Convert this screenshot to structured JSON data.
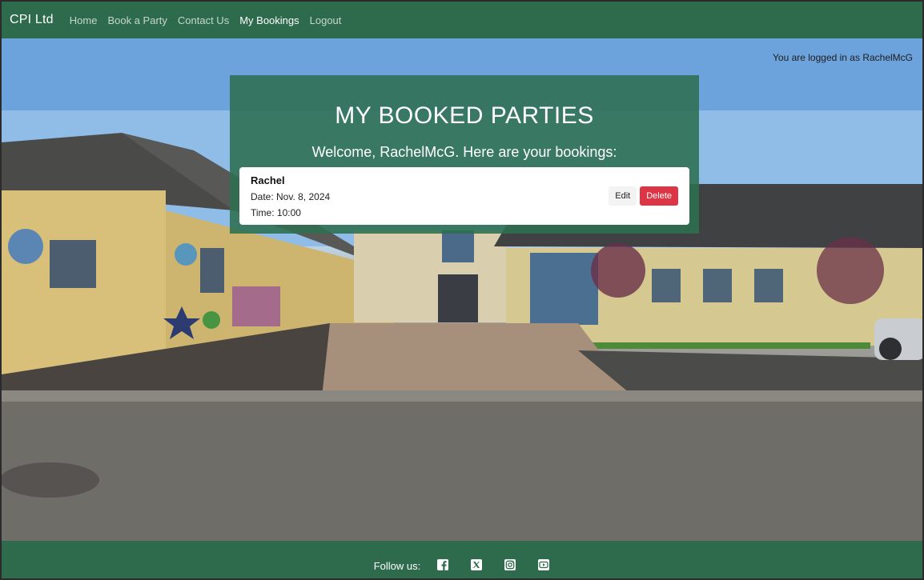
{
  "navbar": {
    "brand": "CPI Ltd",
    "links": [
      {
        "label": "Home"
      },
      {
        "label": "Book a Party"
      },
      {
        "label": "Contact Us"
      },
      {
        "label": "My Bookings"
      },
      {
        "label": "Logout"
      }
    ],
    "active": "My Bookings"
  },
  "status": {
    "logged_in_text": "You are logged in as RachelMcG"
  },
  "main": {
    "title": "MY BOOKED PARTIES",
    "welcome": "Welcome, RachelMcG. Here are your bookings:",
    "bookings": [
      {
        "name": "Rachel",
        "date": "Date: Nov. 8, 2024",
        "time": "Time: 10:00",
        "edit_label": "Edit",
        "delete_label": "Delete"
      }
    ]
  },
  "footer": {
    "follow_label": "Follow us:",
    "social_icons": [
      "facebook-icon",
      "x-twitter-icon",
      "instagram-icon",
      "youtube-icon"
    ]
  },
  "colors": {
    "brand_green": "#2e6b4d",
    "delete_red": "#dc3545"
  }
}
